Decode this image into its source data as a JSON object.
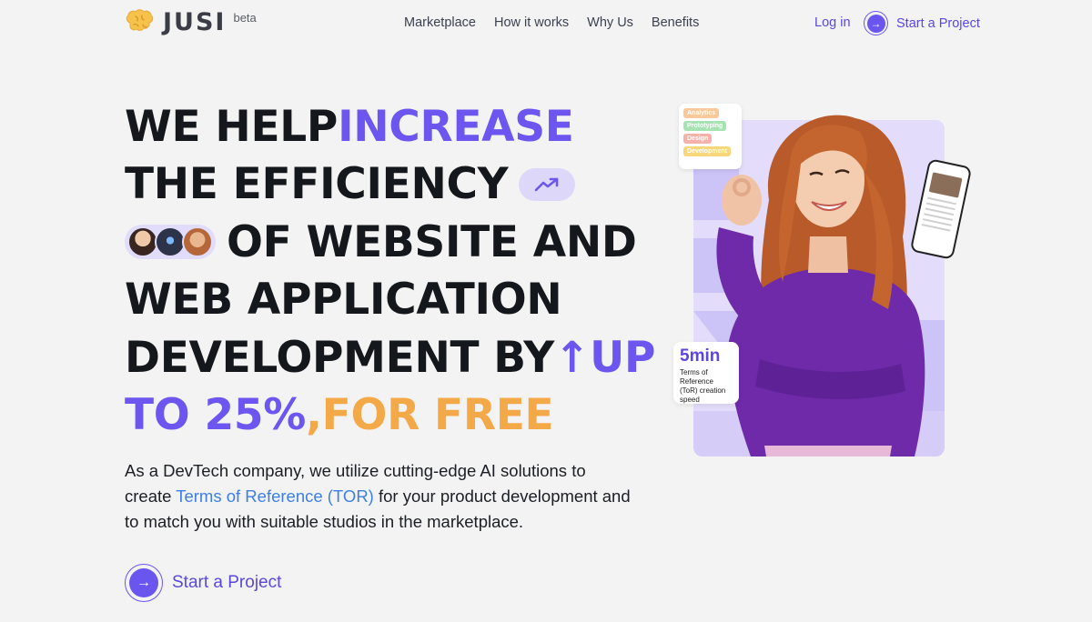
{
  "header": {
    "logo_text": "JUSI",
    "logo_badge": "beta",
    "nav": [
      {
        "label": "Marketplace"
      },
      {
        "label": "How it works"
      },
      {
        "label": "Why Us"
      },
      {
        "label": "Benefits"
      }
    ],
    "login_label": "Log in",
    "cta_label": "Start a Project"
  },
  "hero": {
    "headline": {
      "l1_a": "WE HELP ",
      "l1_b": "INCREASE",
      "l2": "THE EFFICIENCY",
      "l3": "OF WEBSITE AND",
      "l4": "WEB APPLICATION",
      "l5_a": "DEVELOPMENT BY ",
      "l5_b": "↑UP",
      "l6_a": "TO 25%",
      "l6_b": ", ",
      "l6_c": "FOR FREE"
    },
    "description": {
      "part1": "As a DevTech company, we utilize cutting-edge AI solutions to create ",
      "link": "Terms of Reference (TOR)",
      "part2": " for your product development and to match you with suitable studios in the marketplace."
    },
    "cta_label": "Start a Project",
    "tags": [
      "Analytics",
      "Prototyping",
      "Design",
      "Development"
    ],
    "stat": {
      "value": "5min",
      "caption": "Terms of Reference (ToR) creation speed"
    }
  },
  "colors": {
    "accent": "#6c56ef",
    "orange": "#f4a948",
    "link": "#3d7fe6",
    "background": "#f3f3f3"
  }
}
